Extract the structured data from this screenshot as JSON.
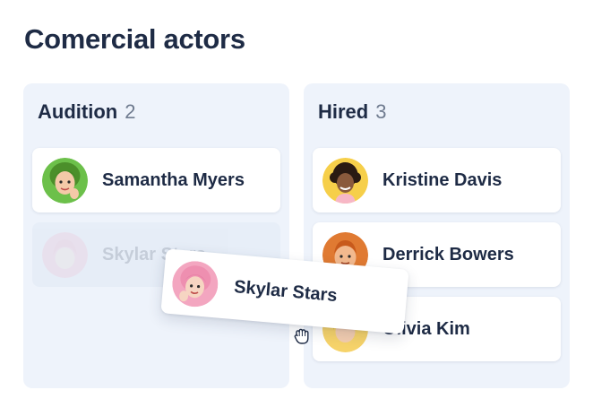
{
  "page": {
    "title": "Comercial actors"
  },
  "columns": [
    {
      "title": "Audition",
      "count": "2",
      "cards": [
        {
          "name": "Samantha Myers",
          "avatar": "avatar-green-hair"
        },
        {
          "name": "Skylar Stars",
          "avatar": "avatar-pink-hair",
          "state": "placeholder"
        }
      ]
    },
    {
      "title": "Hired",
      "count": "3",
      "cards": [
        {
          "name": "Kristine Davis",
          "avatar": "avatar-curly-dark-hair"
        },
        {
          "name": "Derrick Bowers",
          "avatar": "avatar-ginger-hair"
        },
        {
          "name": "Olivia Kim",
          "avatar": "avatar-blonde-hair"
        }
      ]
    }
  ],
  "dragging": {
    "name": "Skylar Stars",
    "avatar": "avatar-pink-hair"
  },
  "cursor": {
    "icon": "grab-hand-icon"
  },
  "colors": {
    "title": "#1e2b45",
    "column_bg": "#eef3fb",
    "count": "#6f7b8f",
    "card_bg": "#ffffff"
  }
}
